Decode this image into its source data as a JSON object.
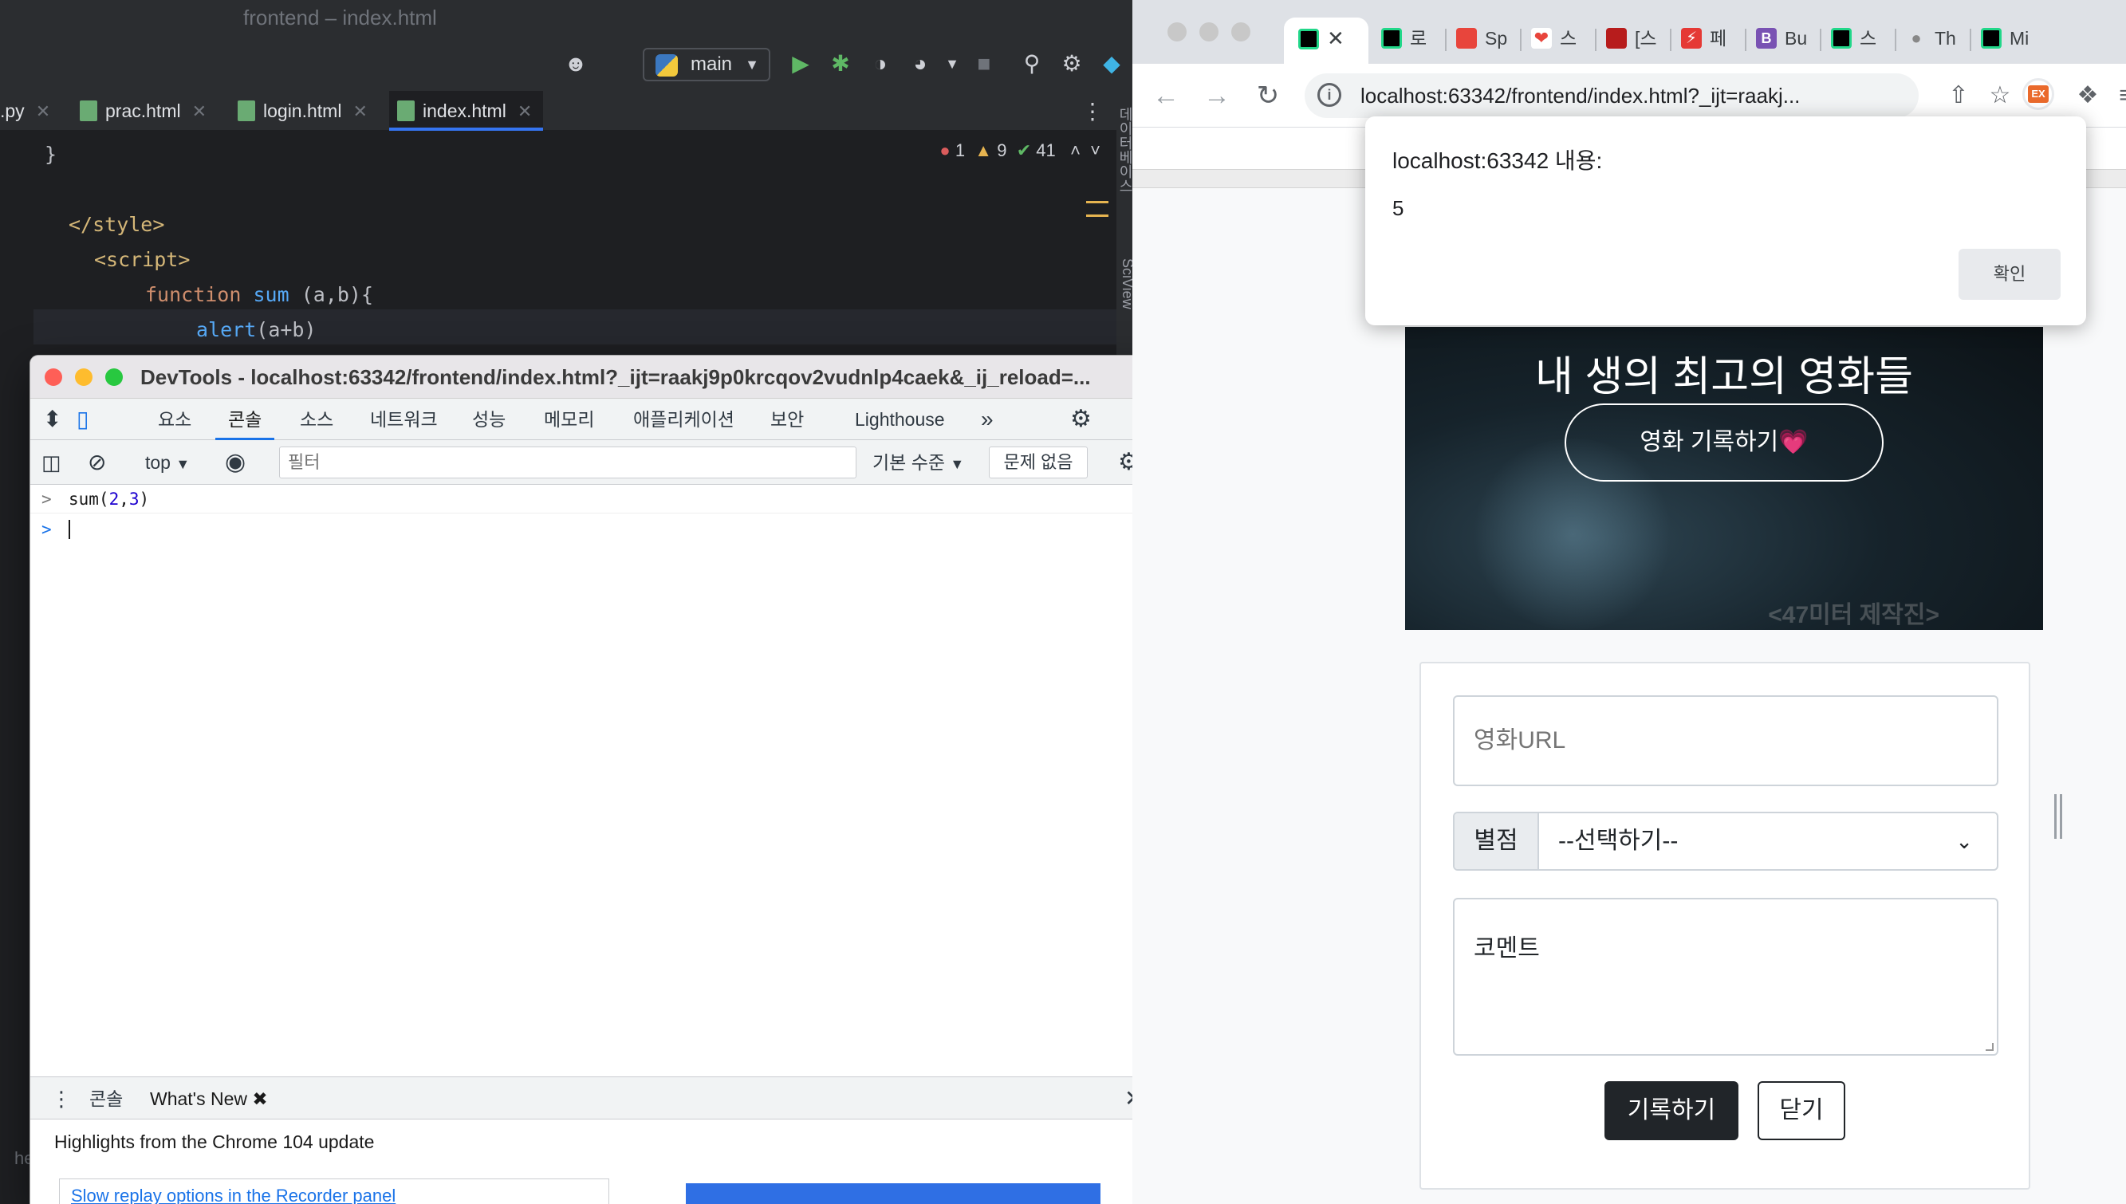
{
  "ide": {
    "title": "frontend – index.html",
    "branch": "main",
    "tabs": [
      {
        "label": ".py"
      },
      {
        "label": "prac.html"
      },
      {
        "label": "login.html"
      },
      {
        "label": "index.html"
      }
    ],
    "inspections": {
      "errors": "1",
      "warnings": "9",
      "ok": "41"
    },
    "code": {
      "l1": "}",
      "l2": "</style>",
      "l3": "<script>",
      "l4_kw": "function",
      "l4_fn": "sum",
      "l4_rest": " (a,b){",
      "l5_call": "alert",
      "l5_rest": "(a+b)"
    },
    "side_labels": [
      "데이터베이스",
      "SciView"
    ],
    "bottom_label": "he"
  },
  "devtools": {
    "title": "DevTools - localhost:63342/frontend/index.html?_ijt=raakj9p0krcqov2vudnlp4caek&_ij_reload=...",
    "tabs": [
      "요소",
      "콘솔",
      "소스",
      "네트워크",
      "성능",
      "메모리",
      "애플리케이션",
      "보안",
      "Lighthouse"
    ],
    "context": "top",
    "filter_placeholder": "필터",
    "levels": "기본 수준",
    "issues": "문제 없음",
    "console_lines": [
      {
        "fn": "sum(",
        "a": "2",
        "comma": ",",
        "b": "3",
        "close": ")"
      }
    ],
    "drawer_tabs": [
      "콘솔",
      "What's New"
    ],
    "highlights": "Highlights from the Chrome 104 update",
    "news_link": "Slow replay options in the Recorder panel"
  },
  "chrome": {
    "tabs": [
      {
        "label": "",
        "color": "#21d789"
      },
      {
        "label": "로",
        "color": "#21d789"
      },
      {
        "label": "Sp",
        "color": "#e8453c"
      },
      {
        "label": "스",
        "color": "#e8453c"
      },
      {
        "label": "[스",
        "color": "#b71c1c"
      },
      {
        "label": "페",
        "color": "#e53935"
      },
      {
        "label": "Bu",
        "color": "#7952b3"
      },
      {
        "label": "스",
        "color": "#21d789"
      },
      {
        "label": "Th",
        "color": "#888888"
      },
      {
        "label": "Mi",
        "color": "#21d789"
      }
    ],
    "url": "localhost:63342/frontend/index.html?_ijt=raakj..."
  },
  "page": {
    "hero_title": "내 생의 최고의 영화들",
    "hero_button": "영화 기록하기",
    "hero_button_emoji": "💗",
    "watermark": "<47미터 제작진>",
    "url_placeholder": "영화URL",
    "star_label": "별점",
    "star_select": "--선택하기--",
    "comment_placeholder": "코멘트",
    "save_button": "기록하기",
    "close_button": "닫기"
  },
  "alert": {
    "title": "localhost:63342 내용:",
    "message": "5",
    "ok": "확인"
  }
}
